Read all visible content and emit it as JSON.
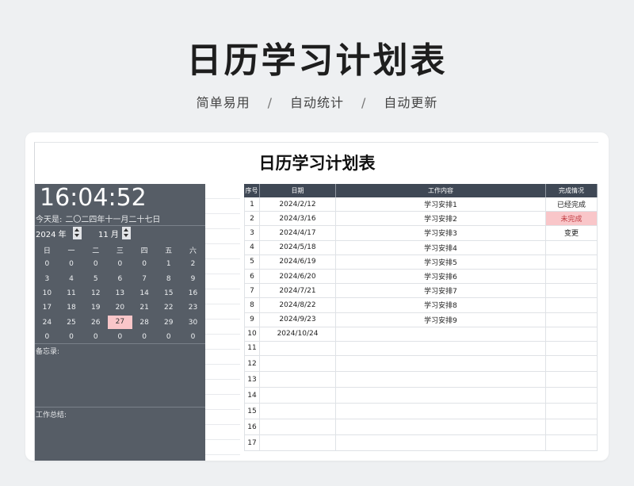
{
  "header": {
    "title": "日历学习计划表",
    "features": [
      "简单易用",
      "自动统计",
      "自动更新"
    ],
    "separator": "/"
  },
  "sheet": {
    "title": "日历学习计划表",
    "clock": "16:04:52",
    "today_label": "今天是:",
    "today_value": "二〇二四年十一月二十七日",
    "year_value": "2024 年",
    "month_value": "11 月",
    "weekdays": [
      "日",
      "一",
      "二",
      "三",
      "四",
      "五",
      "六"
    ],
    "calendar": [
      [
        "0",
        "0",
        "0",
        "0",
        "0",
        "1",
        "2"
      ],
      [
        "3",
        "4",
        "5",
        "6",
        "7",
        "8",
        "9"
      ],
      [
        "10",
        "11",
        "12",
        "13",
        "14",
        "15",
        "16"
      ],
      [
        "17",
        "18",
        "19",
        "20",
        "21",
        "22",
        "23"
      ],
      [
        "24",
        "25",
        "26",
        "27",
        "28",
        "29",
        "30"
      ],
      [
        "0",
        "0",
        "0",
        "0",
        "0",
        "0",
        "0"
      ]
    ],
    "highlight_day": "27",
    "memo_label": "备忘录:",
    "summary_label": "工作总结:"
  },
  "table": {
    "columns": [
      "序号",
      "日期",
      "工作内容",
      "完成情况"
    ],
    "rows": [
      [
        "1",
        "2024/2/12",
        "学习安排1",
        "已经完成"
      ],
      [
        "2",
        "2024/3/16",
        "学习安排2",
        "未完成"
      ],
      [
        "3",
        "2024/4/17",
        "学习安排3",
        "变更"
      ],
      [
        "4",
        "2024/5/18",
        "学习安排4",
        ""
      ],
      [
        "5",
        "2024/6/19",
        "学习安排5",
        ""
      ],
      [
        "6",
        "2024/6/20",
        "学习安排6",
        ""
      ],
      [
        "7",
        "2024/7/21",
        "学习安排7",
        ""
      ],
      [
        "8",
        "2024/8/22",
        "学习安排8",
        ""
      ],
      [
        "9",
        "2024/9/23",
        "学习安排9",
        ""
      ],
      [
        "10",
        "2024/10/24",
        "",
        ""
      ],
      [
        "11",
        "",
        "",
        ""
      ],
      [
        "12",
        "",
        "",
        ""
      ],
      [
        "13",
        "",
        "",
        ""
      ],
      [
        "14",
        "",
        "",
        ""
      ],
      [
        "15",
        "",
        "",
        ""
      ],
      [
        "16",
        "",
        "",
        ""
      ],
      [
        "17",
        "",
        "",
        ""
      ]
    ]
  },
  "colors": {
    "panel": "#565d66",
    "table_header": "#3f4855",
    "highlight": "#f9c6c9"
  }
}
